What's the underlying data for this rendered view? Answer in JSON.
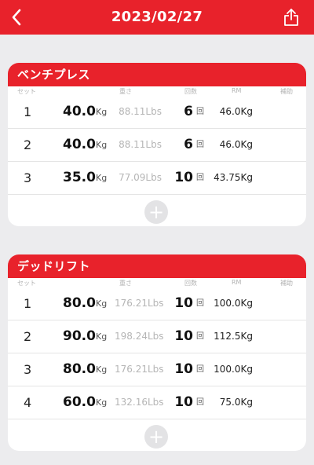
{
  "header": {
    "title": "2023/02/27",
    "back_icon": "chevron-left-icon",
    "share_icon": "share-icon",
    "accent_color": "#e8222b"
  },
  "column_labels": {
    "set": "セット",
    "weight": "重さ",
    "reps": "回数",
    "rm": "RM",
    "assist": "補助"
  },
  "exercises": [
    {
      "name": "ベンチプレス",
      "sets": [
        {
          "set": "1",
          "kg": "40.0",
          "kg_unit": "Kg",
          "lbs": "88.11Lbs",
          "reps": "6",
          "reps_unit": "回",
          "rm": "46.0Kg"
        },
        {
          "set": "2",
          "kg": "40.0",
          "kg_unit": "Kg",
          "lbs": "88.11Lbs",
          "reps": "6",
          "reps_unit": "回",
          "rm": "46.0Kg"
        },
        {
          "set": "3",
          "kg": "35.0",
          "kg_unit": "Kg",
          "lbs": "77.09Lbs",
          "reps": "10",
          "reps_unit": "回",
          "rm": "43.75Kg"
        }
      ],
      "add_label": "+"
    },
    {
      "name": "デッドリフト",
      "sets": [
        {
          "set": "1",
          "kg": "80.0",
          "kg_unit": "Kg",
          "lbs": "176.21Lbs",
          "reps": "10",
          "reps_unit": "回",
          "rm": "100.0Kg"
        },
        {
          "set": "2",
          "kg": "90.0",
          "kg_unit": "Kg",
          "lbs": "198.24Lbs",
          "reps": "10",
          "reps_unit": "回",
          "rm": "112.5Kg"
        },
        {
          "set": "3",
          "kg": "80.0",
          "kg_unit": "Kg",
          "lbs": "176.21Lbs",
          "reps": "10",
          "reps_unit": "回",
          "rm": "100.0Kg"
        },
        {
          "set": "4",
          "kg": "60.0",
          "kg_unit": "Kg",
          "lbs": "132.16Lbs",
          "reps": "10",
          "reps_unit": "回",
          "rm": "75.0Kg"
        }
      ],
      "add_label": "+"
    }
  ]
}
